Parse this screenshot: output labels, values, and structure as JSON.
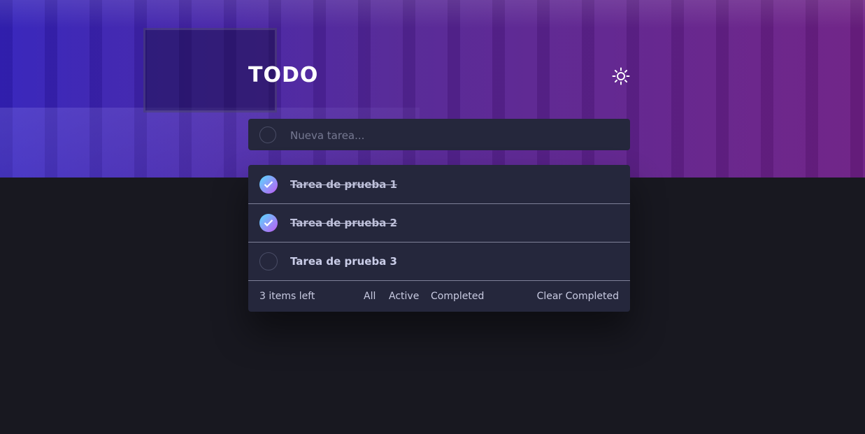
{
  "app": {
    "title": "TODO",
    "theme_toggle_icon": "sun-icon"
  },
  "new_task": {
    "placeholder": "Nueva tarea...",
    "value": ""
  },
  "tasks": [
    {
      "label": "Tarea de prueba 1",
      "completed": true
    },
    {
      "label": "Tarea de prueba 2",
      "completed": true
    },
    {
      "label": "Tarea de prueba 3",
      "completed": false
    }
  ],
  "footer": {
    "items_left": "3 items left",
    "filters": [
      "All",
      "Active",
      "Completed"
    ],
    "clear_completed": "Clear Completed"
  },
  "colors": {
    "accent_gradient_start": "#57ddff",
    "accent_gradient_end": "#c058f3",
    "card_bg": "#25273c",
    "page_bg": "#181820"
  }
}
